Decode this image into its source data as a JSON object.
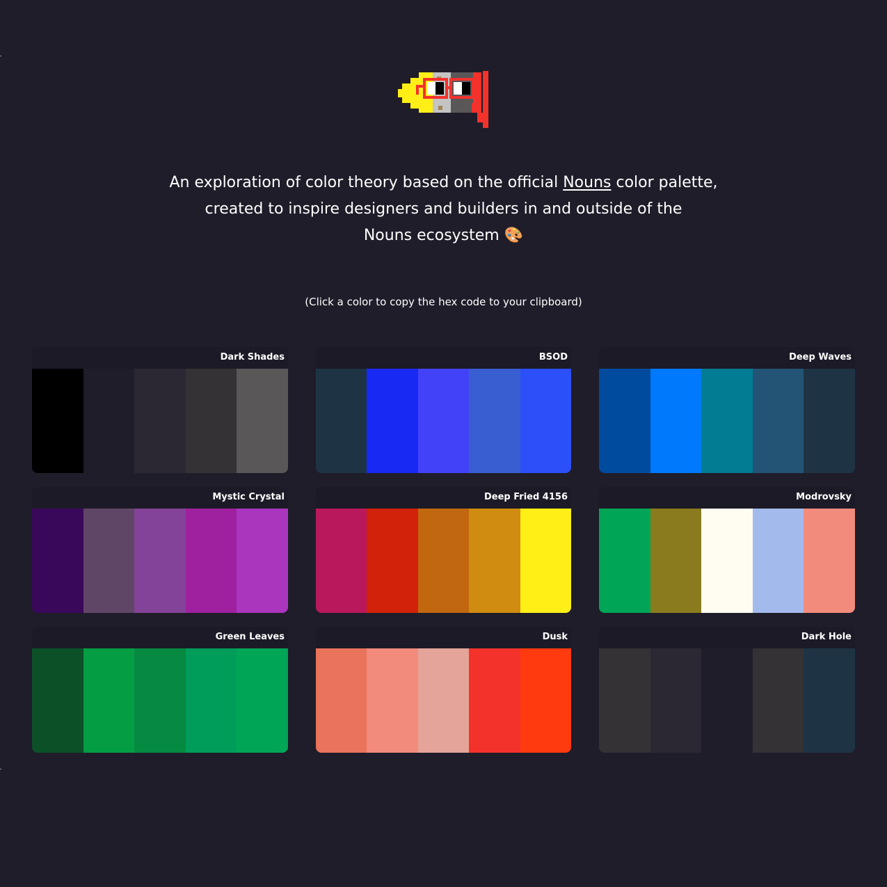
{
  "header": {
    "logo_icon": "nouns-glasses-icon"
  },
  "intro": {
    "line1_prefix": "An exploration of color theory based on the official ",
    "link_text": "Nouns",
    "line1_suffix": " color palette,",
    "line2": "created to inspire designers and builders in and outside of the",
    "line3": "Nouns ecosystem",
    "emoji": "🎨"
  },
  "hint": "(Click a color to copy the hex code to your clipboard)",
  "palettes": [
    {
      "name": "Dark Shades",
      "colors": [
        "#000000",
        "#1f1d29",
        "#2b2834",
        "#343235",
        "#5a5759"
      ]
    },
    {
      "name": "BSOD",
      "colors": [
        "#1e3445",
        "#1929f4",
        "#4243f8",
        "#395ed1",
        "#2b4ff9"
      ]
    },
    {
      "name": "Deep Waves",
      "colors": [
        "#004b9e",
        "#0079fc",
        "#027c92",
        "#235476",
        "#1e3445"
      ]
    },
    {
      "name": "Mystic Crystal",
      "colors": [
        "#3a085b",
        "#604666",
        "#834398",
        "#9f21a0",
        "#ab36be"
      ]
    },
    {
      "name": "Deep Fried 4156",
      "colors": [
        "#b9185c",
        "#d22209",
        "#c16710",
        "#d08b11",
        "#ffef16"
      ]
    },
    {
      "name": "Modrovsky",
      "colors": [
        "#00a556",
        "#8a7b1e",
        "#fffdf2",
        "#a3baed",
        "#f38b7c"
      ]
    },
    {
      "name": "Green Leaves",
      "colors": [
        "#0b5027",
        "#049d43",
        "#068940",
        "#009c59",
        "#00a556"
      ]
    },
    {
      "name": "Dusk",
      "colors": [
        "#e9735b",
        "#f38b7c",
        "#e4a499",
        "#f3322c",
        "#ff3a0e"
      ]
    },
    {
      "name": "Dark Hole",
      "colors": [
        "#343235",
        "#2b2834",
        "#1f1d29",
        "#343235",
        "#1e3445"
      ]
    }
  ]
}
